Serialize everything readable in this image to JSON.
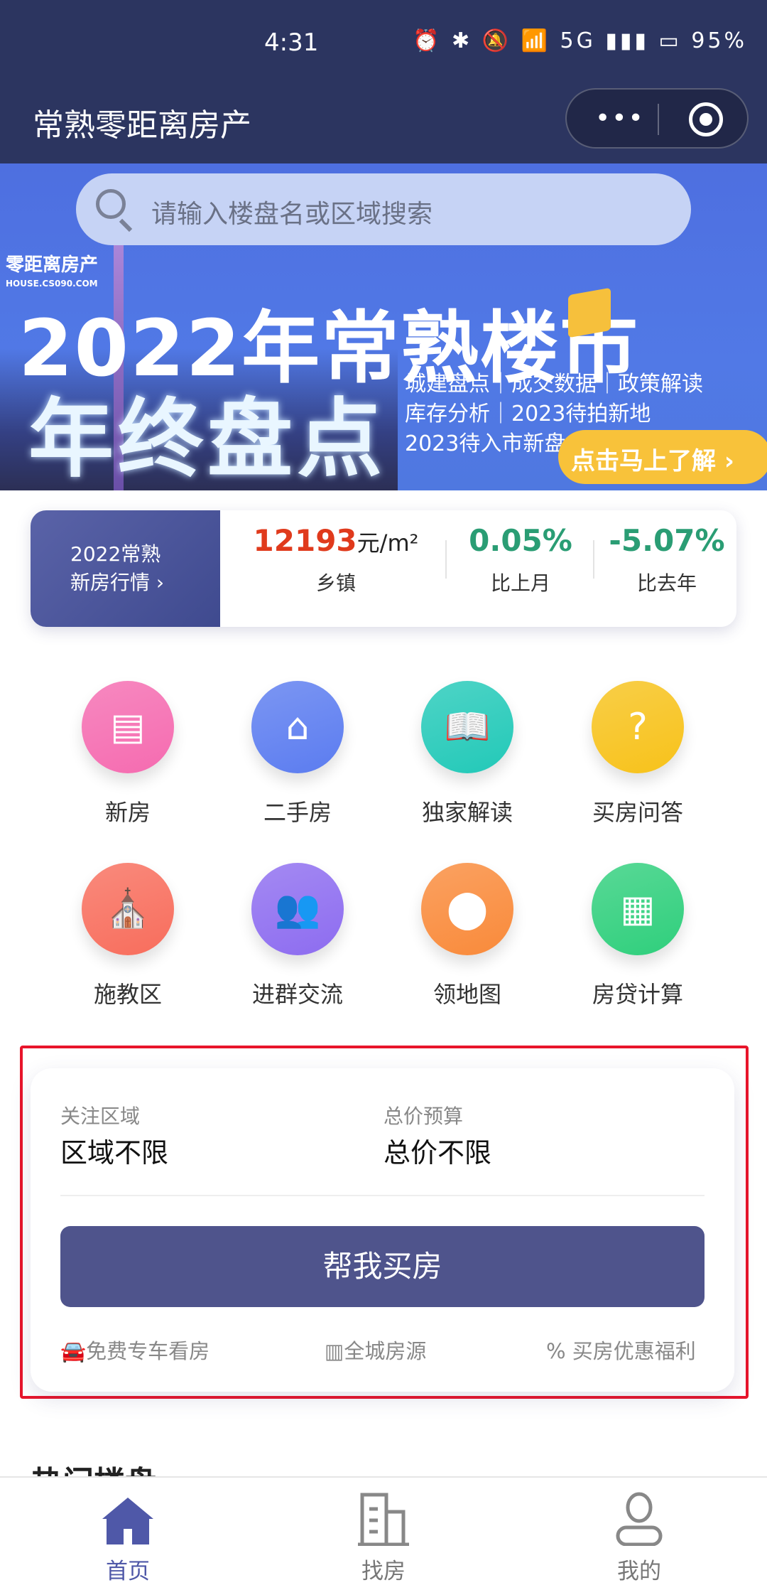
{
  "status_bar": {
    "time": "4:31",
    "icons": "⏰ ✱ 🔕 📶 5G ▮▮▮ ▭",
    "battery": "95%"
  },
  "header": {
    "title": "常熟零距离房产",
    "more_icon": "•••",
    "target_icon": "record-icon"
  },
  "search": {
    "placeholder": "请输入楼盘名或区域搜索"
  },
  "banner": {
    "logo": "零距离房产",
    "logo_sub": "HOUSE.CS090.COM",
    "title1": "2022年常熟楼市",
    "title2": "年终盘点",
    "lines": [
      "城建盘点｜成交数据｜政策解读",
      "库存分析｜2023待拍新地",
      "2023待入市新盘"
    ],
    "cta": "点击马上了解 ›"
  },
  "market": {
    "label_line1": "2022常熟",
    "label_line2": "新房行情 ›",
    "price": "12193",
    "price_unit": "元/m²",
    "price_label": "乡镇",
    "mom": "0.05%",
    "mom_label": "比上月",
    "yoy": "-5.07%",
    "yoy_label": "比去年",
    "colors": {
      "price": "#e03a1c",
      "change": "#2a9d74"
    }
  },
  "grid": [
    {
      "label": "新房",
      "icon": "building-icon",
      "color": "#f56bb0"
    },
    {
      "label": "二手房",
      "icon": "house-tie-icon",
      "color": "#5b7cf0"
    },
    {
      "label": "独家解读",
      "icon": "book-icon",
      "color": "#22c9b8"
    },
    {
      "label": "买房问答",
      "icon": "question-bubble-icon",
      "color": "#f7c21a"
    },
    {
      "label": "施教区",
      "icon": "school-icon",
      "color": "#f86d5c"
    },
    {
      "label": "进群交流",
      "icon": "group-icon",
      "color": "#8d6cf0"
    },
    {
      "label": "领地图",
      "icon": "map-pin-icon",
      "color": "#f98a3a"
    },
    {
      "label": "房贷计算",
      "icon": "calculator-icon",
      "color": "#2fcf7c"
    }
  ],
  "buy_card": {
    "area_label": "关注区域",
    "area_value": "区域不限",
    "budget_label": "总价预算",
    "budget_value": "总价不限",
    "button": "帮我买房",
    "features": [
      "免费专车看房",
      "全城房源",
      "买房优惠福利"
    ]
  },
  "section_title": "热门楼盘",
  "tabbar": [
    {
      "label": "首页",
      "active": true
    },
    {
      "label": "找房"
    },
    {
      "label": "我的"
    }
  ],
  "accent": "#4f548c"
}
